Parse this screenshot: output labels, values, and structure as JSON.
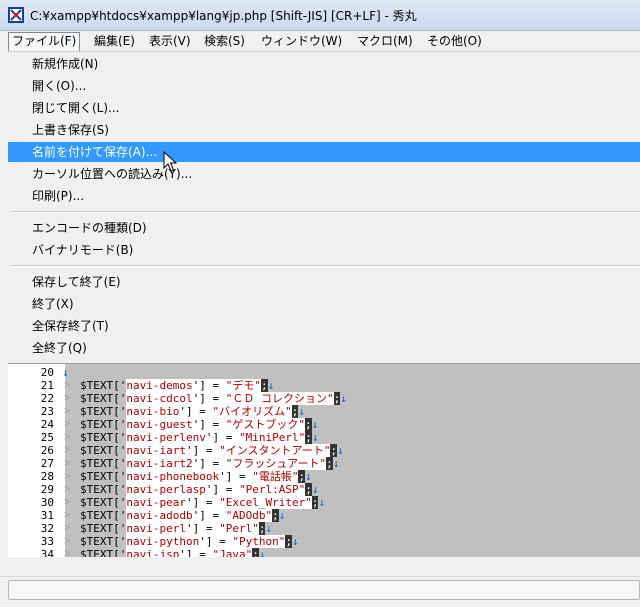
{
  "window": {
    "title": "C:¥xampp¥htdocs¥xampp¥lang¥jp.php  [Shift-JIS] [CR+LF] - 秀丸"
  },
  "menubar": {
    "items": [
      {
        "label": "ファイル(F)",
        "open": true
      },
      {
        "label": "編集(E)"
      },
      {
        "label": "表示(V)"
      },
      {
        "label": "検索(S)"
      },
      {
        "label": "ウィンドウ(W)"
      },
      {
        "label": "マクロ(M)"
      },
      {
        "label": "その他(O)"
      }
    ]
  },
  "file_menu": {
    "items": [
      {
        "label": "新規作成(N)"
      },
      {
        "label": "開く(O)..."
      },
      {
        "label": "閉じて開く(L)..."
      },
      {
        "label": "上書き保存(S)"
      },
      {
        "label": "名前を付けて保存(A)...",
        "highlighted": true
      },
      {
        "label": "カーソル位置への読込み(Y)..."
      },
      {
        "label": "印刷(P)..."
      },
      {
        "label": "エンコードの種類(D)"
      },
      {
        "label": "バイナリモード(B)"
      },
      {
        "label": "保存して終了(E)"
      },
      {
        "label": "終了(X)"
      },
      {
        "label": "全保存終了(T)"
      },
      {
        "label": "全終了(Q)"
      }
    ]
  },
  "editor": {
    "lines": [
      {
        "num": "20",
        "var": "",
        "key": "",
        "val": ""
      },
      {
        "num": "21",
        "var": "$TEXT['",
        "key": "navi-demos",
        "val": "\"デモ\""
      },
      {
        "num": "22",
        "var": "$TEXT['",
        "key": "navi-cdcol",
        "val": "\"ＣＤ コレクション\""
      },
      {
        "num": "23",
        "var": "$TEXT['",
        "key": "navi-bio",
        "val": "\"バイオリズム\""
      },
      {
        "num": "24",
        "var": "$TEXT['",
        "key": "navi-guest",
        "val": "\"ゲストブック\""
      },
      {
        "num": "25",
        "var": "$TEXT['",
        "key": "navi-perlenv",
        "val": "\"MiniPerl\""
      },
      {
        "num": "26",
        "var": "$TEXT['",
        "key": "navi-iart",
        "val": "\"インスタントアート\""
      },
      {
        "num": "27",
        "var": "$TEXT['",
        "key": "navi-iart2",
        "val": "\"フラッシュアート\""
      },
      {
        "num": "28",
        "var": "$TEXT['",
        "key": "navi-phonebook",
        "val": "\"電話帳\""
      },
      {
        "num": "29",
        "var": "$TEXT['",
        "key": "navi-perlasp",
        "val": "\"Perl:ASP\""
      },
      {
        "num": "30",
        "var": "$TEXT['",
        "key": "navi-pear",
        "val": "\"Excel_Writer\""
      },
      {
        "num": "31",
        "var": "$TEXT['",
        "key": "navi-adodb",
        "val": "\"ADOdb\""
      },
      {
        "num": "32",
        "var": "$TEXT['",
        "key": "navi-perl",
        "val": "\"Perl\""
      },
      {
        "num": "33",
        "var": "$TEXT['",
        "key": "navi-python",
        "val": "\"Python\""
      },
      {
        "num": "34",
        "var": "$TEXT['",
        "key": "navi-jsp",
        "val": "\"Java\""
      }
    ],
    "assign": "'] = ",
    "return_mark": "↓",
    "tab_mark": "˃"
  },
  "colors": {
    "highlight": "#3399ff",
    "string": "#b00000",
    "editor_bg": "#c0c0c0"
  }
}
